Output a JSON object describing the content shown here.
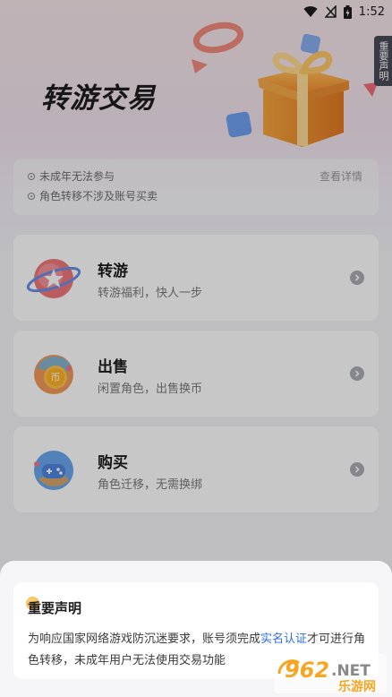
{
  "status_bar": {
    "time": "1:52"
  },
  "hero": {
    "title": "转游交易",
    "side_tab": "重要声明"
  },
  "notice": {
    "lines": [
      "未成年无法参与",
      "角色转移不涉及账号买卖"
    ],
    "details_link": "查看详情"
  },
  "cards": [
    {
      "title": "转游",
      "subtitle": "转游福利，快人一步",
      "icon": "star-planet-icon"
    },
    {
      "title": "出售",
      "subtitle": "闲置角色，出售换币",
      "icon": "coin-planet-icon"
    },
    {
      "title": "购买",
      "subtitle": "角色迁移，无需换绑",
      "icon": "gamepad-planet-icon"
    }
  ],
  "sheet": {
    "title": "重要声明",
    "body_before": "为响应国家网络游戏防沉迷要求，账号须完成",
    "body_link": "实名认证",
    "body_after": "才可进行角色转移，未成年用户无法使用交易功能"
  },
  "watermark": {
    "number": "962",
    "suffix": ".NET",
    "site": "乐游网"
  },
  "colors": {
    "link": "#2c6de6",
    "overlay": "rgba(0,0,0,0.22)"
  }
}
